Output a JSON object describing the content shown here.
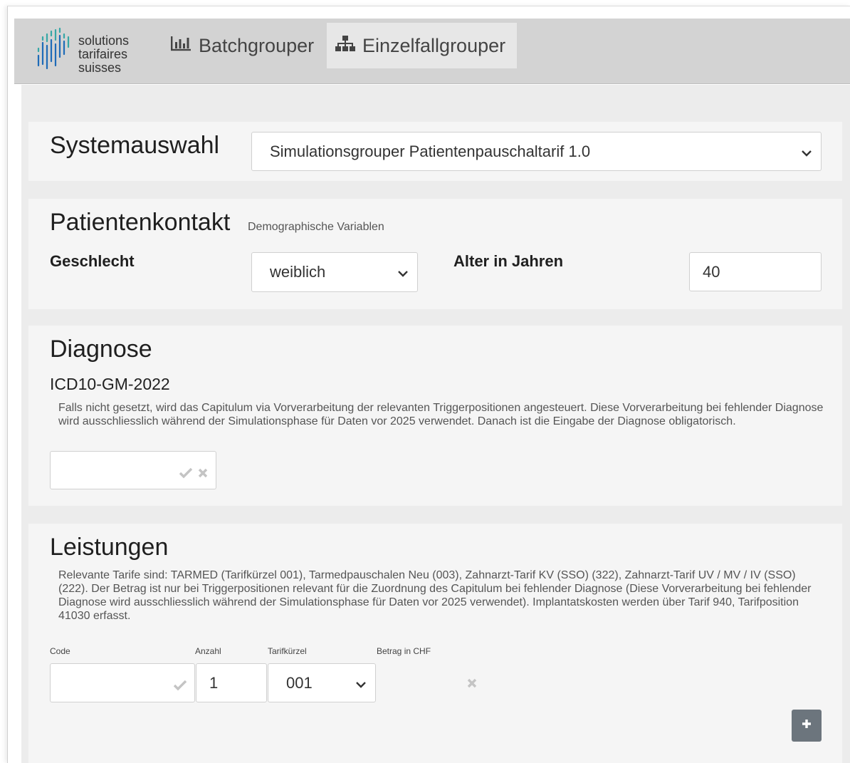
{
  "logo": {
    "line1": "solutions",
    "line2": "tarifaires",
    "line3": "suisses"
  },
  "nav": {
    "batch_label": "Batchgrouper",
    "einzel_label": "Einzelfallgrouper"
  },
  "system": {
    "heading": "Systemauswahl",
    "selected": "Simulationsgrouper Patientenpauschaltarif 1.0"
  },
  "patient": {
    "heading": "Patientenkontakt",
    "subheading": "Demographische Variablen",
    "sex_label": "Geschlecht",
    "sex_value": "weiblich",
    "age_label": "Alter in Jahren",
    "age_value": "40"
  },
  "diagnose": {
    "heading": "Diagnose",
    "catalog": "ICD10-GM-2022",
    "help": "Falls nicht gesetzt, wird das Capitulum via Vorverarbeitung der relevanten Triggerpositionen angesteuert. Diese Vorverarbeitung bei fehlender Diagnose wird ausschliesslich während der Simulationsphase für Daten vor 2025 verwendet. Danach ist die Eingabe der Diagnose obligatorisch.",
    "input_value": ""
  },
  "leistungen": {
    "heading": "Leistungen",
    "help": "Relevante Tarife sind: TARMED (Tarifkürzel 001), Tarmedpauschalen Neu (003), Zahnarzt-Tarif KV (SSO) (322), Zahnarzt-Tarif UV / MV / IV (SSO) (222). Der Betrag ist nur bei Triggerpositionen relevant für die Zuordnung des Capitulum bei fehlender Diagnose (Diese Vorverarbeitung bei fehlender Diagnose wird ausschliesslich während der Simulationsphase für Daten vor 2025 verwendet). Implantatskosten werden über Tarif 940, Tarifposition 41030 erfasst.",
    "col_code": "Code",
    "col_anzahl": "Anzahl",
    "col_tarif": "Tarifkürzel",
    "col_betrag": "Betrag in CHF",
    "row": {
      "code": "",
      "anzahl": "1",
      "tarif": "001"
    }
  },
  "icons": {
    "batch": "bar-chart-icon",
    "einzel": "sitemap-icon",
    "check": "check-icon",
    "close": "close-icon",
    "plus": "plus-icon",
    "caret": "chevron-down-icon"
  },
  "colors": {
    "header_bg": "#d3d3d3",
    "active_tab_bg": "#e7e7e7",
    "card_bg": "#f5f5f5",
    "page_bg": "#ececec",
    "plus_button": "#6c757d",
    "logo_blue": "#1e6bb8",
    "logo_teal": "#36a7a6"
  }
}
